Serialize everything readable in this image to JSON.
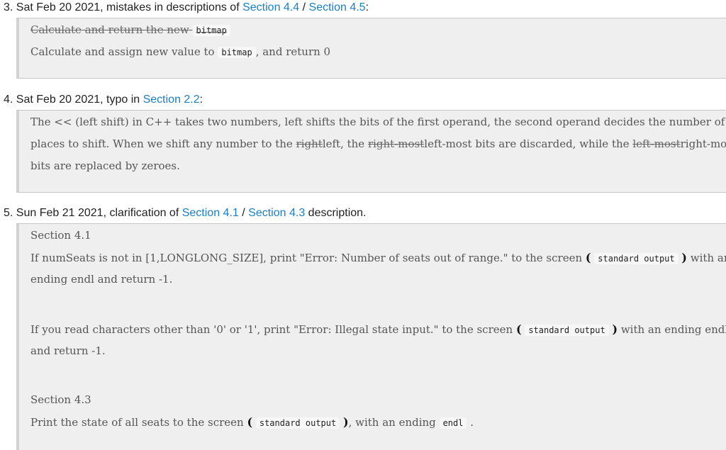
{
  "entries": [
    {
      "number": "3.",
      "prefix": "Sat Feb 20 2021, mistakes in descriptions of",
      "links": [
        "Section 4.4",
        "Section 4.5"
      ],
      "separator": "/",
      "suffix": ":",
      "struck_text": "Calculate and return the new",
      "struck_code": "bitmap",
      "new_text_a": "Calculate and assign new value to",
      "new_code": "bitmap",
      "new_text_b": ", and return 0"
    },
    {
      "number": "4.",
      "prefix": "Sat Feb 20 2021, typo in",
      "links": [
        "Section 2.2"
      ],
      "suffix": ":",
      "line1": "The << (left shift) in C++ takes two numbers, left shifts the bits of the first operand, the second operand decides the number of",
      "line2_a": "places to shift. When we shift any number to the",
      "line2_s1": "right",
      "line2_b": "left, the",
      "line2_s2": "right-most",
      "line2_c": "left-most bits are discarded, while the",
      "line2_s3": "left-most",
      "line2_d": "right-most",
      "line3": "bits are replaced by zeroes."
    },
    {
      "number": "5.",
      "prefix": "Sun Feb 21 2021, clarification of",
      "links": [
        "Section 4.1",
        "Section 4.3"
      ],
      "separator": "/",
      "suffix": "description.",
      "sec1_title": "Section 4.1",
      "sec1_line1_a": "If numSeats is not in [1,LONGLONG_SIZE], print \"Error: Number of seats out of range.\" to the screen",
      "sec1_code": "standard output",
      "sec1_line1_b": "with an",
      "sec1_line2": "ending endl and return -1.",
      "sec1_para2_a": "If you read characters other than '0' or '1', print \"Error: Illegal state input.\" to the screen",
      "sec1_code2": "standard output",
      "sec1_para2_b": "with an ending endl",
      "sec1_para2_line2": "and return -1.",
      "sec3_title": "Section 4.3",
      "sec3_a": "Print the state of all seats to the screen",
      "sec3_code": "standard output",
      "sec3_b": ", with an ending",
      "sec3_code2": "endl",
      "sec3_c": "."
    }
  ],
  "colors": {
    "link": "#1a7fc1",
    "box_bg": "#efefef"
  }
}
